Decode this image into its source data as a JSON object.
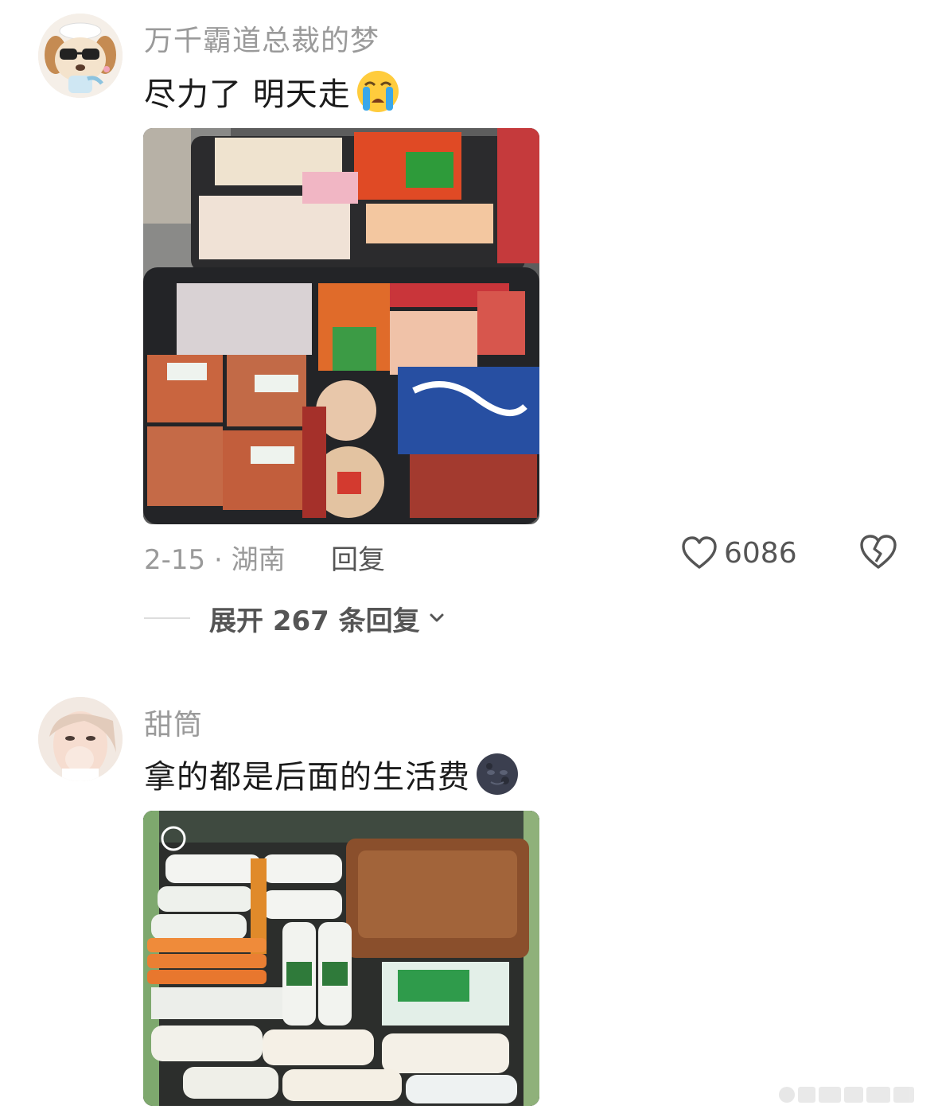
{
  "comments": [
    {
      "username": "万千霸道总裁的梦",
      "text": "尽力了 明天走",
      "emoji": "loudly-crying-face",
      "photo": "suitcase-full-of-snacks-photo",
      "date_location": "2-15 · 湖南",
      "reply_label": "回复",
      "like_count": "6086",
      "expand_label": "展开 267 条回复"
    },
    {
      "username": "甜筒",
      "text": "拿的都是后面的生活费",
      "emoji": "new-moon-face",
      "photo": "suitcase-full-of-milk-bottles-photo"
    }
  ],
  "colors": {
    "username": "#9a9a9a",
    "text": "#1b1b1b",
    "meta": "#9a9a9a",
    "action": "#555555"
  }
}
